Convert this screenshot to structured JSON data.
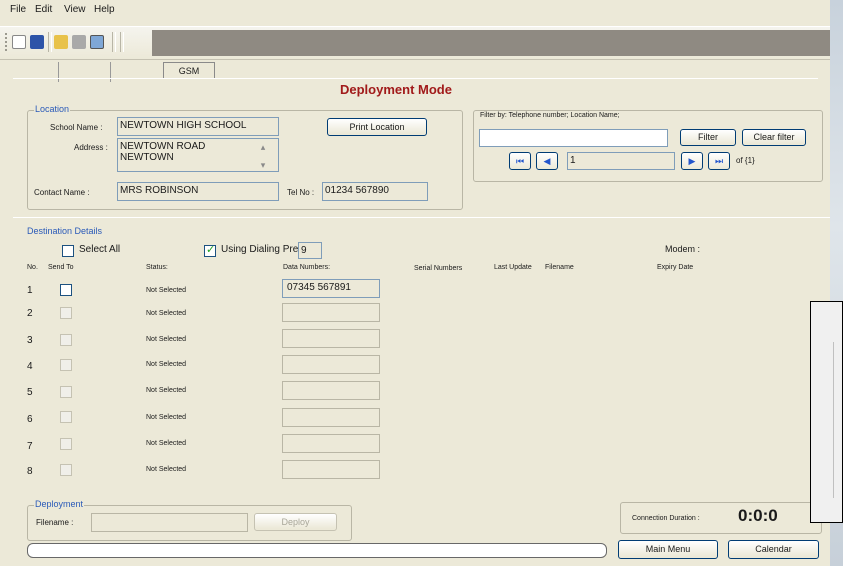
{
  "menu": [
    "File",
    "Edit",
    "View",
    "Help"
  ],
  "tabs": {
    "active": "GSM"
  },
  "page_title": "Deployment Mode",
  "location": {
    "legend": "Location",
    "school_label": "School Name :",
    "school_value": "NEWTOWN HIGH SCHOOL",
    "address_label": "Address :",
    "address_line1": "NEWTOWN ROAD",
    "address_line2": "NEWTOWN",
    "contact_label": "Contact Name :",
    "contact_value": "MRS ROBINSON",
    "tel_label": "Tel No :",
    "tel_value": "01234 567890",
    "print_button": "Print Location"
  },
  "filter": {
    "label": "Filter by: Telephone number; Location Name;",
    "input_value": "",
    "filter_button": "Filter",
    "clear_button": "Clear filter",
    "record_value": "1",
    "of_text": "of  {1}"
  },
  "destination": {
    "legend": "Destination Details",
    "select_all": "Select All",
    "dialing_prefix_label": "Using Dialing Prefix :",
    "dialing_prefix_value": "9",
    "modem_label": "Modem :",
    "columns": {
      "no": "No.",
      "send_to": "Send To",
      "status": "Status:",
      "data_numbers": "Data Numbers:",
      "serial_numbers": "Serial Numbers",
      "last_update": "Last Update",
      "filename": "Filename",
      "expiry_date": "Expiry Date"
    },
    "rows": [
      {
        "no": "1",
        "status": "Not Selected",
        "number": "07345 567891"
      },
      {
        "no": "2",
        "status": "Not Selected",
        "number": ""
      },
      {
        "no": "3",
        "status": "Not Selected",
        "number": ""
      },
      {
        "no": "4",
        "status": "Not Selected",
        "number": ""
      },
      {
        "no": "5",
        "status": "Not Selected",
        "number": ""
      },
      {
        "no": "6",
        "status": "Not Selected",
        "number": ""
      },
      {
        "no": "7",
        "status": "Not Selected",
        "number": ""
      },
      {
        "no": "8",
        "status": "Not Selected",
        "number": ""
      }
    ]
  },
  "deployment": {
    "legend": "Deployment",
    "filename_label": "Filename :",
    "filename_value": "",
    "deploy_button": "Deploy"
  },
  "connection": {
    "label": "Connection Duration :",
    "value": "0:0:0"
  },
  "bottom": {
    "main_menu": "Main Menu",
    "calendar": "Calendar"
  },
  "colors": {
    "title": "#a11a1a",
    "legend": "#2a5ab8",
    "window": "#ece9d8"
  }
}
